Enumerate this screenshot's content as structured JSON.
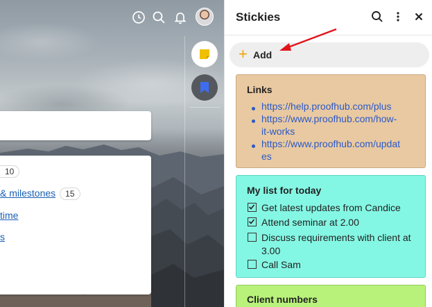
{
  "left_app": {
    "list_rows": [
      {
        "label": "",
        "badge": "10"
      },
      {
        "label": "& milestones",
        "badge": "15"
      },
      {
        "label": "time",
        "badge": ""
      },
      {
        "label": "s",
        "badge": ""
      }
    ]
  },
  "stickies": {
    "title": "Stickies",
    "add_label": "Add",
    "notes": [
      {
        "title": "Links",
        "color": "#e9c9a1",
        "links": [
          {
            "lines": [
              "https://help.proofhub.com/plus"
            ]
          },
          {
            "lines": [
              "https://www.proofhub.com/how-",
              "it-works"
            ]
          },
          {
            "lines": [
              "https://www.proofhub.com/updat",
              "es"
            ]
          }
        ]
      },
      {
        "title": "My list for today",
        "color": "#84f7e4",
        "items": [
          {
            "text": "Get latest updates from Candice",
            "checked": true
          },
          {
            "text": "Attend seminar at 2.00",
            "checked": true
          },
          {
            "text": "Discuss requirements with client at 3.00",
            "checked": false
          },
          {
            "text": "Call Sam",
            "checked": false
          }
        ]
      },
      {
        "title": "Client numbers",
        "color": "#b9f27a"
      }
    ]
  },
  "icons": {
    "timer": "clock-icon",
    "search": "search-icon",
    "notifications": "bell-icon",
    "stickies": "sticky-note-icon",
    "bookmarks": "bookmark-icon",
    "panel_search": "search-icon",
    "panel_more": "more-vertical-icon",
    "panel_close": "close-icon"
  },
  "colors": {
    "accent": "#f0a500",
    "link": "#2a59c8",
    "bookmark_blue": "#3d6cf0",
    "annotation_arrow": "#e0141b"
  }
}
